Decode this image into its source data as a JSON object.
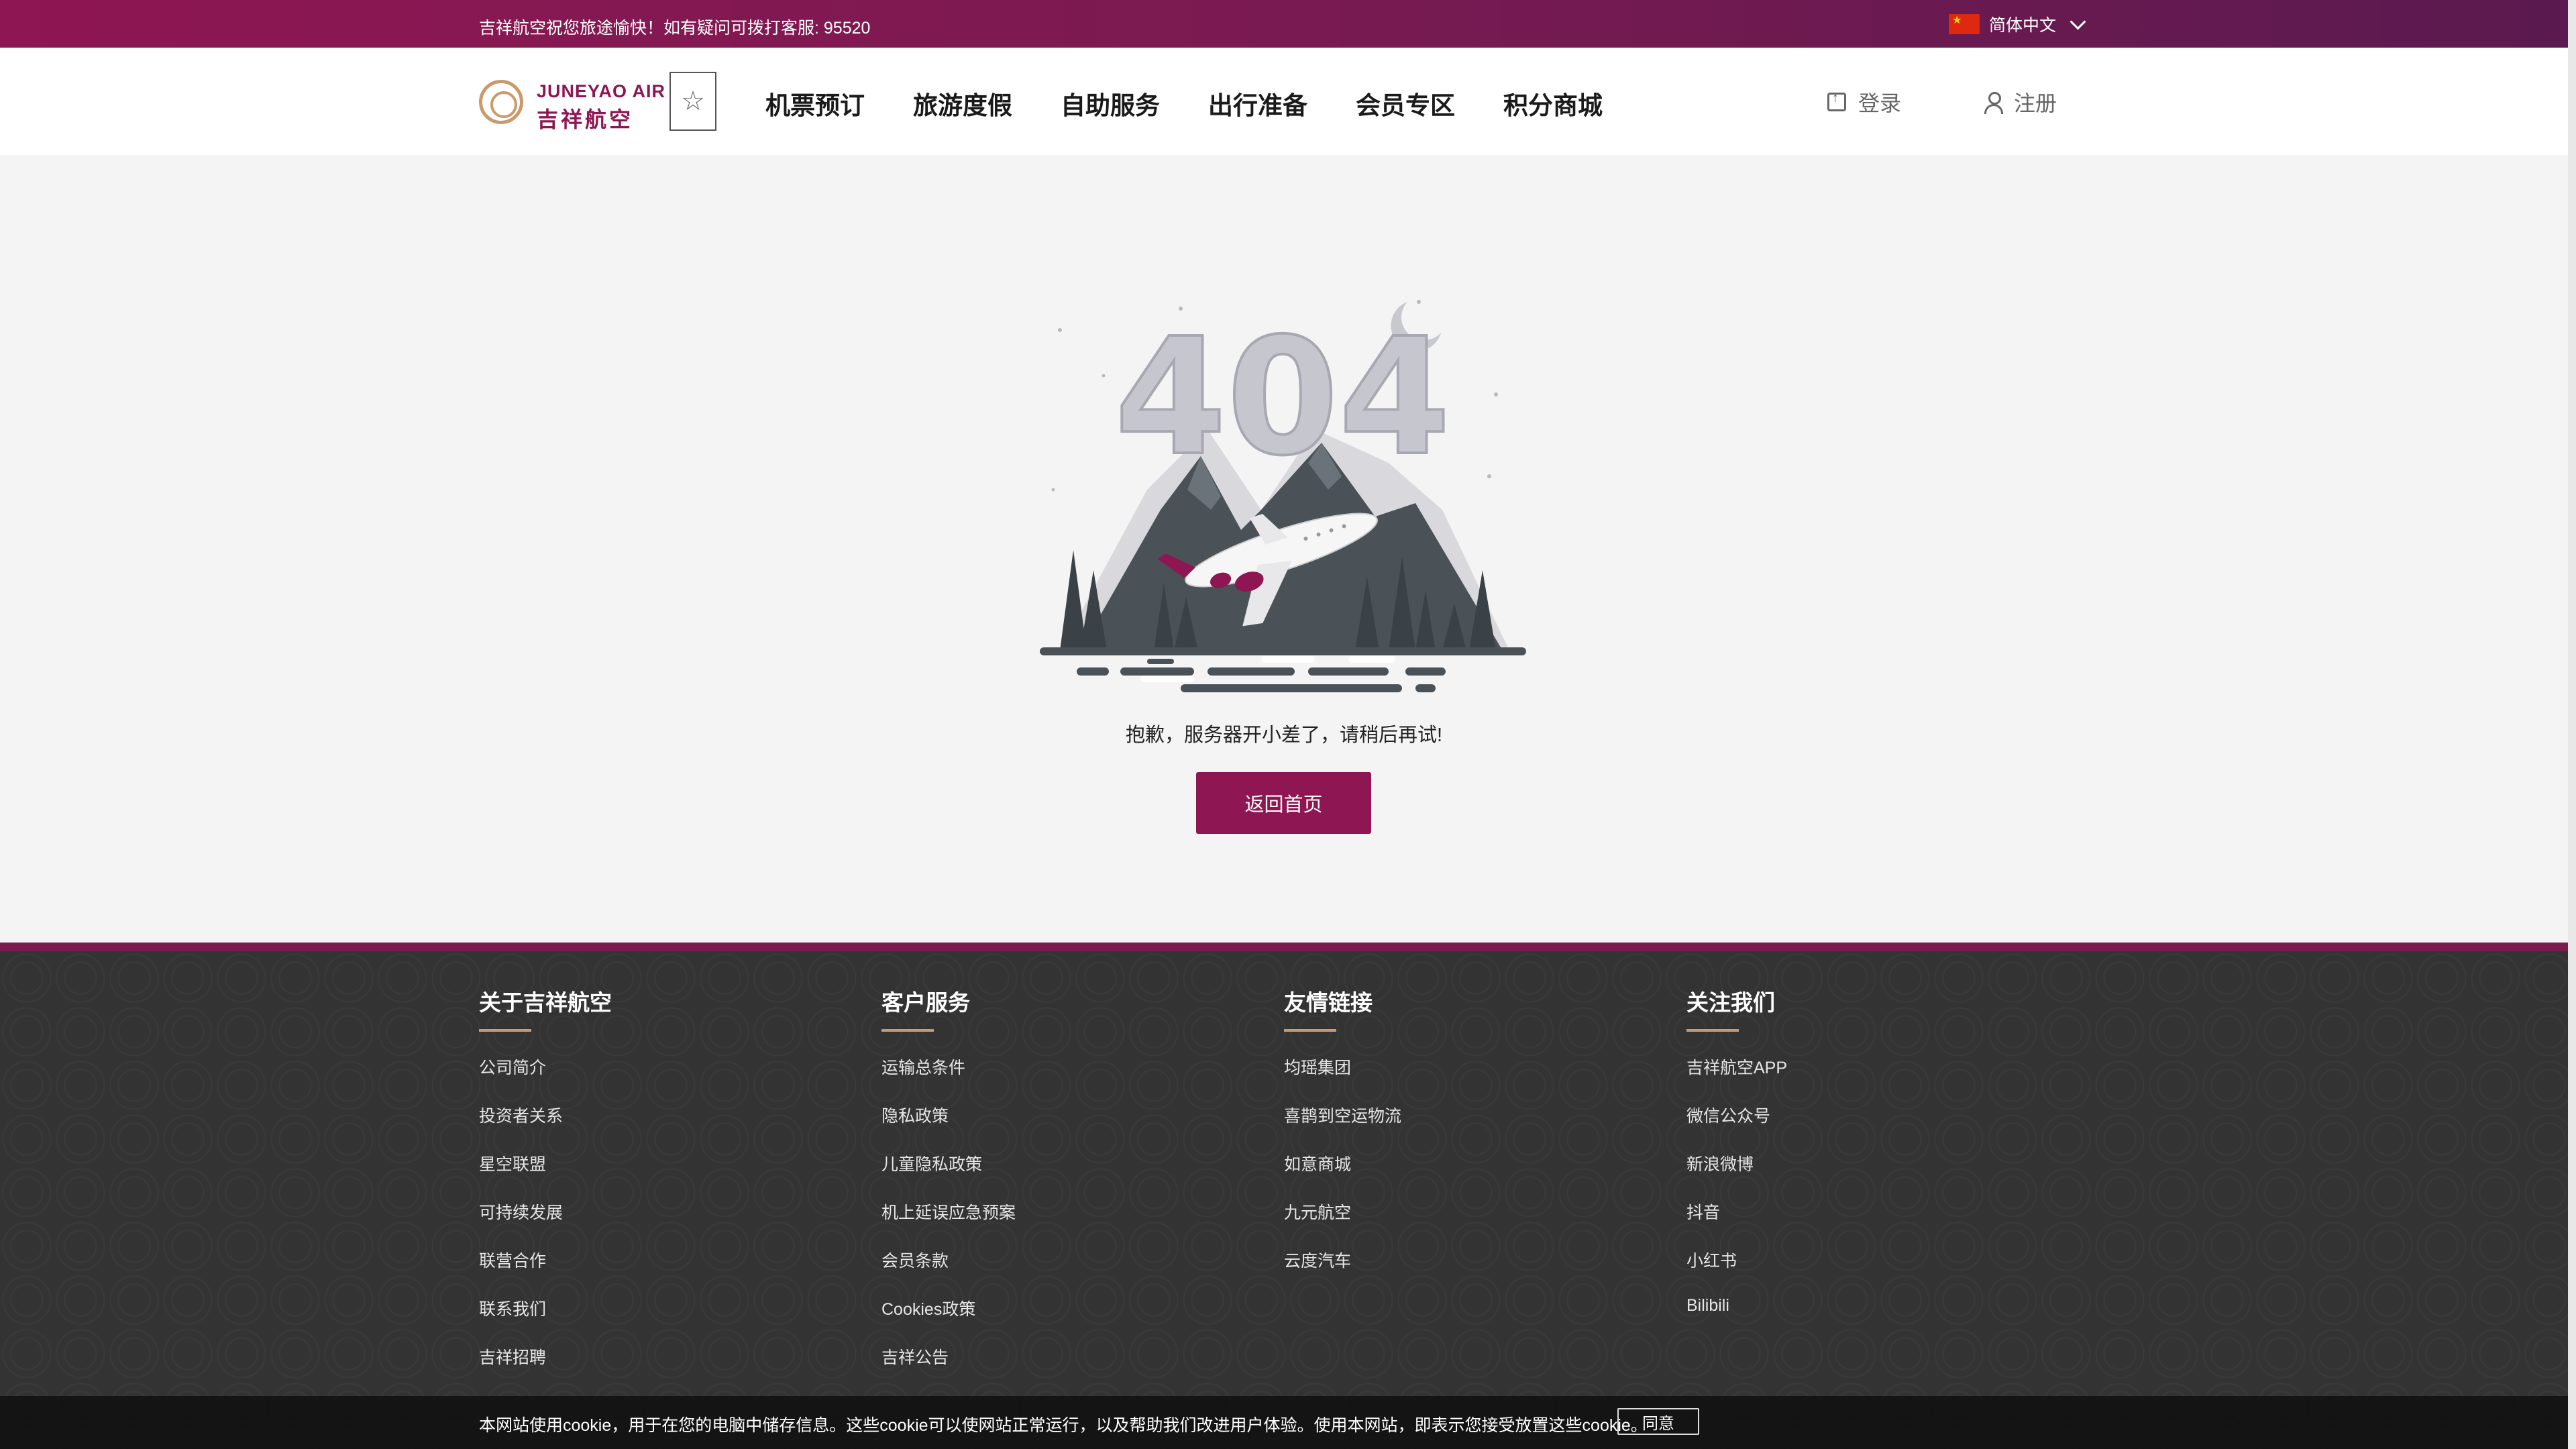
{
  "topbar": {
    "greeting": "吉祥航空祝您旅途愉快！如有疑问可拨打客服: 95520",
    "language": "简体中文"
  },
  "header": {
    "logo_en": "JUNEYAO AIR",
    "logo_cn": "吉祥航空",
    "nav": [
      "机票预订",
      "旅游度假",
      "自助服务",
      "出行准备",
      "会员专区",
      "积分商城"
    ],
    "login": "登录",
    "register": "注册"
  },
  "main": {
    "error_code": "404",
    "message": "抱歉，服务器开小差了，请稍后再试!",
    "home_button": "返回首页"
  },
  "footer": {
    "columns": [
      {
        "title": "关于吉祥航空",
        "items": [
          "公司简介",
          "投资者关系",
          "星空联盟",
          "可持续发展",
          "联营合作",
          "联系我们",
          "吉祥招聘"
        ]
      },
      {
        "title": "客户服务",
        "items": [
          "运输总条件",
          "隐私政策",
          "儿童隐私政策",
          "机上延误应急预案",
          "会员条款",
          "Cookies政策",
          "吉祥公告"
        ]
      },
      {
        "title": "友情链接",
        "items": [
          "均瑶集团",
          "喜鹊到空运物流",
          "如意商城",
          "九元航空",
          "云度汽车"
        ]
      },
      {
        "title": "关注我们",
        "items": [
          "吉祥航空APP",
          "微信公众号",
          "新浪微博",
          "抖音",
          "小红书",
          "Bilibili"
        ]
      }
    ]
  },
  "cookie": {
    "text": "本网站使用cookie，用于在您的电脑中储存信息。这些cookie可以使网站正常运行，以及帮助我们改进用户体验。使用本网站，即表示您接受放置这些cookie。",
    "agree": "同意"
  },
  "colors": {
    "brand": "#8e1652",
    "gold": "#c99a6b",
    "footer_bg": "#333333"
  }
}
